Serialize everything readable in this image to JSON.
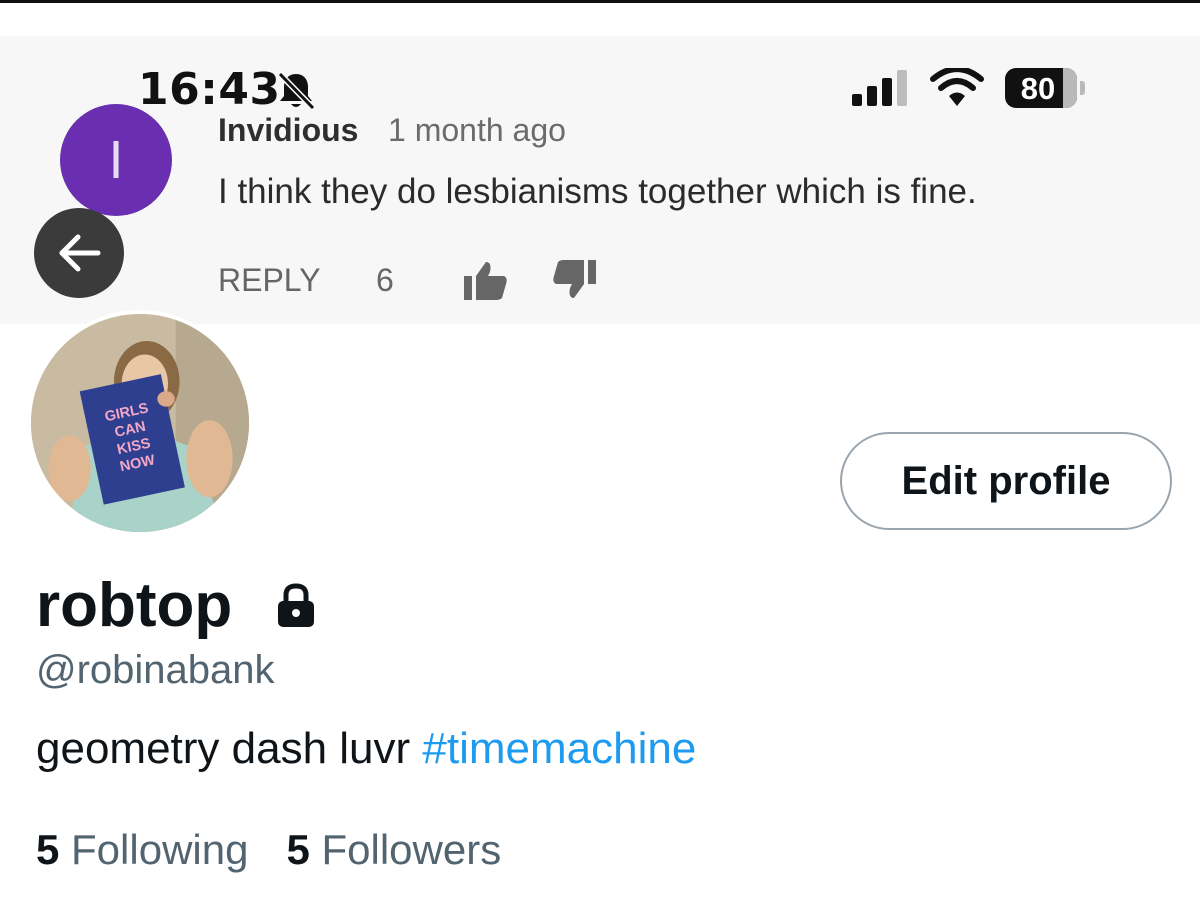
{
  "status_bar": {
    "time": "16:43",
    "battery": "80",
    "battery_level": 0.8,
    "icons": [
      "bell-slash-icon",
      "cellular-signal-icon",
      "wifi-icon",
      "battery-icon"
    ]
  },
  "header_comment": {
    "avatar_letter": "I",
    "avatar_color": "#6a2fb0",
    "author": "Invidious",
    "time_ago": "1 month ago",
    "text": "I think they do lesbianisms together which is fine.",
    "reply_label": "REPLY",
    "like_count": "6",
    "icons": [
      "thumb-up-icon",
      "thumb-down-icon"
    ]
  },
  "navigation": {
    "back_icon": "arrow-left-icon"
  },
  "profile": {
    "avatar_book_text": [
      "GIRLS",
      "CAN",
      "KISS",
      "NOW"
    ],
    "edit_button_label": "Edit profile",
    "display_name": "robtop",
    "locked_icon": "lock-icon",
    "handle": "@robinabank",
    "bio_text": "geometry dash luvr ",
    "bio_hashtag": "#timemachine",
    "following_count": "5",
    "following_label": "Following",
    "followers_count": "5",
    "followers_label": "Followers"
  },
  "colors": {
    "link": "#1d9bf0",
    "secondary_text": "#536471",
    "primary_text": "#0f1419"
  }
}
